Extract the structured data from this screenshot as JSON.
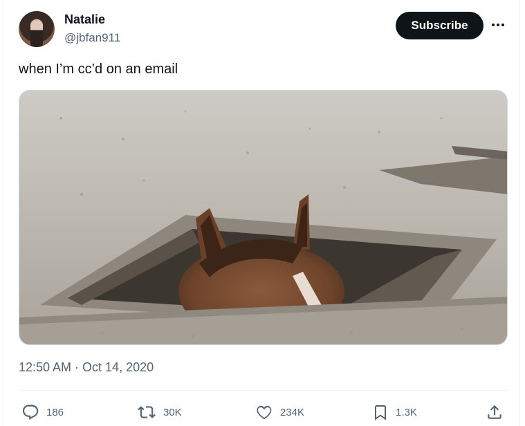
{
  "author": {
    "name": "Natalie",
    "handle": "@jbfan911"
  },
  "header": {
    "subscribe_label": "Subscribe"
  },
  "tweet": {
    "text": "when I’m cc’d on an email",
    "timestamp": "12:50 AM · Oct 14, 2020"
  },
  "media": {
    "description_icon": "horse-in-manhole-image"
  },
  "actions": {
    "replies": "186",
    "reposts": "30K",
    "likes": "234K",
    "bookmarks": "1.3K"
  },
  "colors": {
    "text": "#0f1419",
    "muted": "#536471",
    "button": "#0f1419"
  }
}
